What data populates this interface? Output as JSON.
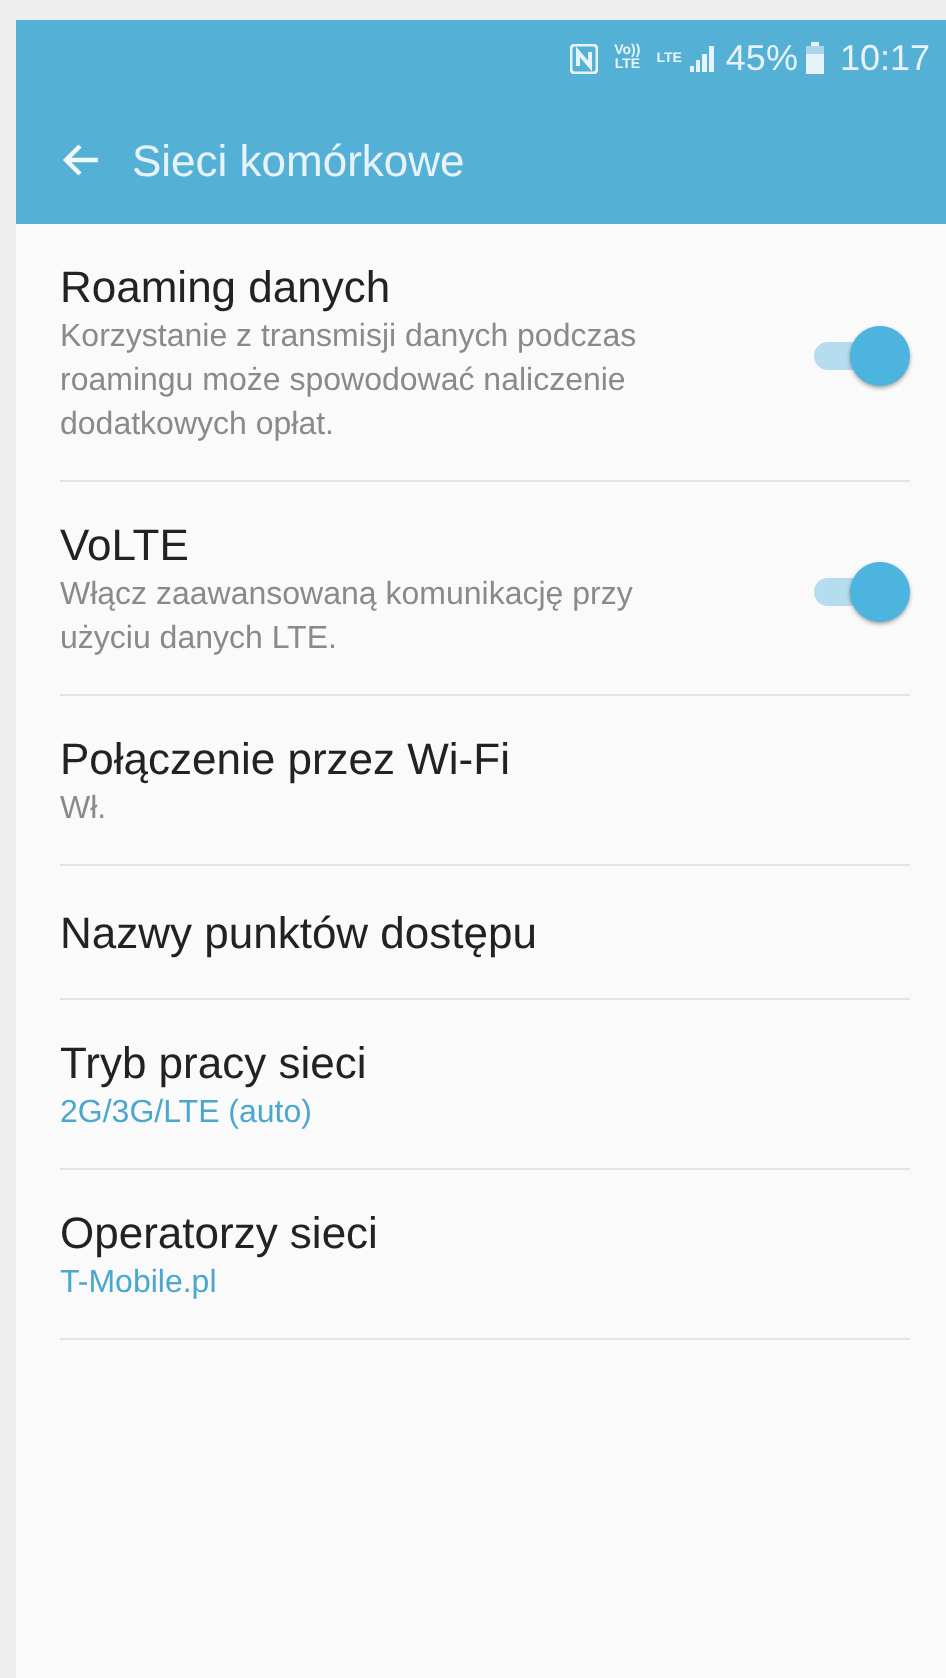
{
  "status_bar": {
    "volte": [
      "Vo))",
      "LTE"
    ],
    "network": "LTE",
    "battery": "45%",
    "time": "10:17"
  },
  "toolbar": {
    "title": "Sieci komórkowe"
  },
  "items": [
    {
      "kind": "toggle",
      "title": "Roaming danych",
      "summary": "Korzystanie z transmisji danych podczas roamingu może spowodować naliczenie dodatkowych opłat.",
      "accent": false,
      "on": true
    },
    {
      "kind": "toggle",
      "title": "VoLTE",
      "summary": "Włącz zaawansowaną komunikację przy użyciu danych LTE.",
      "accent": false,
      "on": true
    },
    {
      "kind": "plain",
      "title": "Połączenie przez Wi-Fi",
      "summary": "Wł.",
      "accent": false
    },
    {
      "kind": "plain",
      "title": "Nazwy punktów dostępu"
    },
    {
      "kind": "plain",
      "title": "Tryb pracy sieci",
      "summary": "2G/3G/LTE (auto)",
      "accent": true
    },
    {
      "kind": "plain",
      "title": "Operatorzy sieci",
      "summary": "T-Mobile.pl",
      "accent": true
    }
  ]
}
